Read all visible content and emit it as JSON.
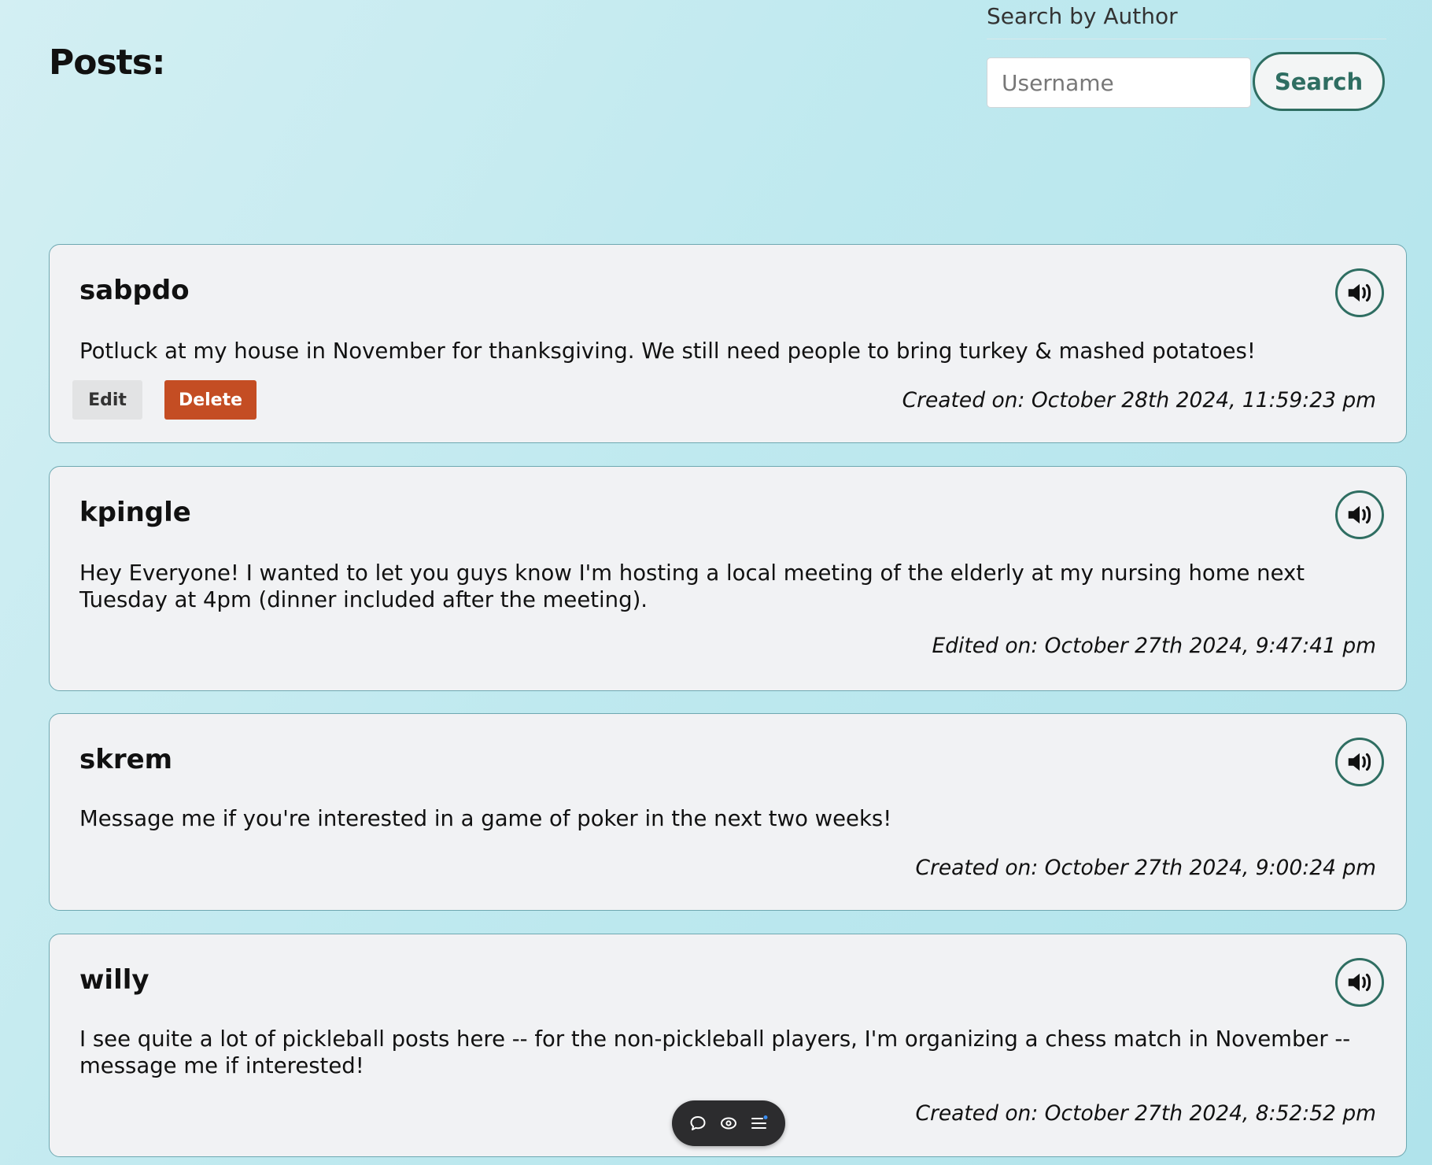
{
  "page": {
    "title": "Posts:"
  },
  "search": {
    "heading": "Search by Author",
    "input_value": "",
    "placeholder": "Username",
    "button_label": "Search"
  },
  "posts": [
    {
      "author": "sabpdo",
      "body": "Potluck at my house in November for thanksgiving. We still need people to bring turkey & mashed potatoes!",
      "timestamp": "Created on: October 28th 2024, 11:59:23 pm",
      "edit_label": "Edit",
      "delete_label": "Delete"
    },
    {
      "author": "kpingle",
      "body": "Hey Everyone! I wanted to let you guys know I'm hosting a local meeting of the elderly at my nursing home next Tuesday at 4pm (dinner included after the meeting).",
      "timestamp": "Edited on: October 27th 2024, 9:47:41 pm"
    },
    {
      "author": "skrem",
      "body": "Message me if you're interested in a game of poker in the next two weeks!",
      "timestamp": "Created on: October 27th 2024, 9:00:24 pm"
    },
    {
      "author": "willy",
      "body": "I see quite a lot of pickleball posts here -- for the non-pickleball players, I'm organizing a chess match in November -- message me if interested!",
      "timestamp": "Created on: October 27th 2024, 8:52:52 pm"
    }
  ],
  "icons": {
    "audio": "speaker-icon",
    "toolbar": [
      "chat-bubble-icon",
      "eye-icon",
      "menu-lines-icon"
    ]
  },
  "colors": {
    "accent": "#2f6e62",
    "delete": "#c44d23",
    "card_background": "#f1f2f4",
    "card_border": "#6ea8b1"
  }
}
